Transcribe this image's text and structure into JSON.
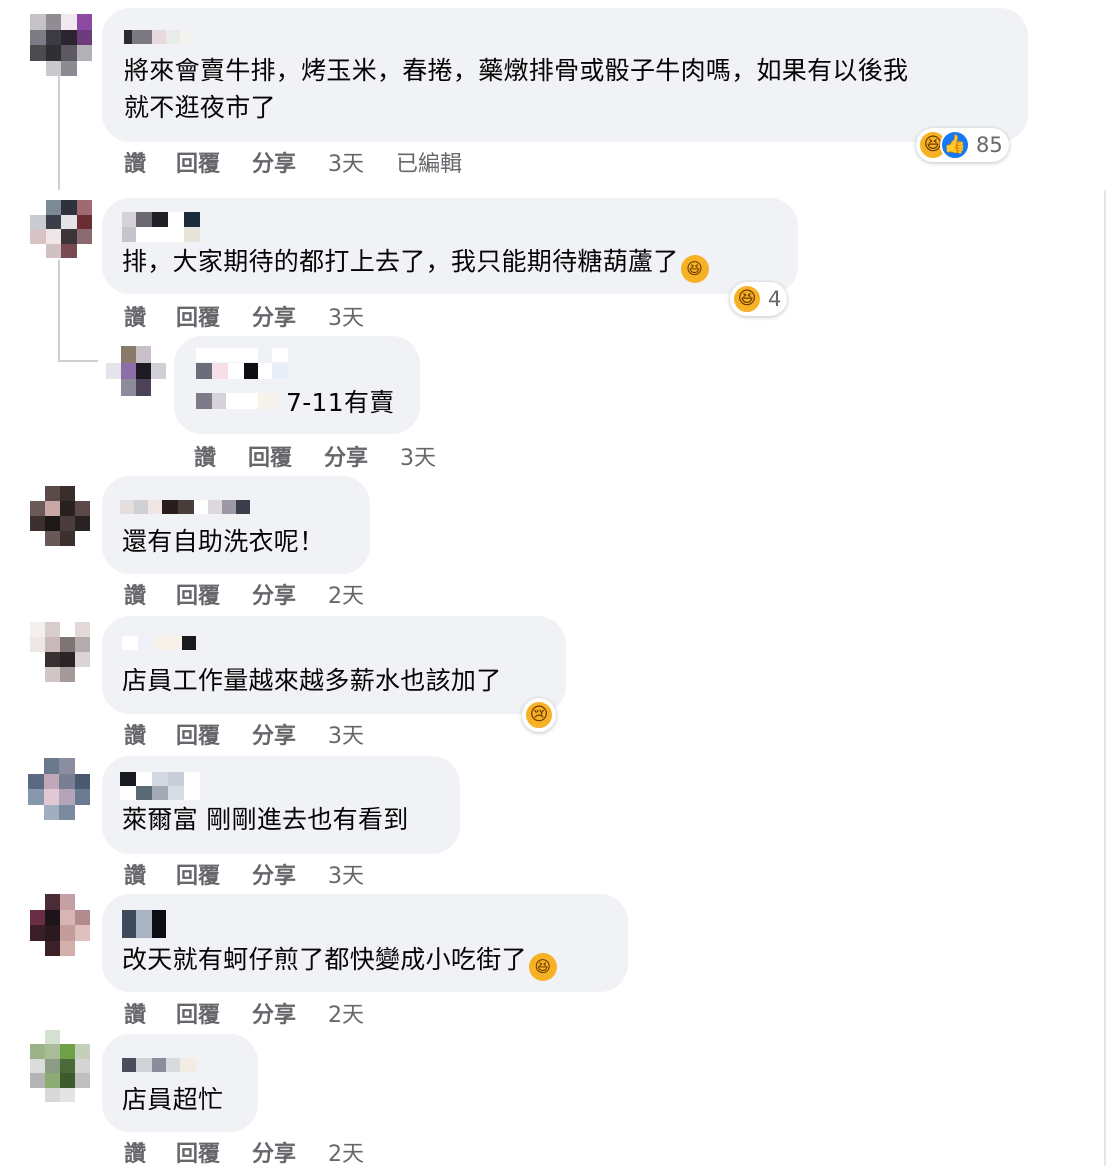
{
  "actions": {
    "like": "讚",
    "reply": "回覆",
    "share": "分享"
  },
  "emoji": {
    "haha": "😆",
    "like": "👍",
    "sad": "😢"
  },
  "comments": [
    {
      "text_line1": "將來會賣牛排，烤玉米，春捲，藥燉排骨或骰子牛肉嗎，如果有以後我",
      "text_line2": "就不逛夜市了",
      "time": "3天",
      "edited": "已編輯",
      "reaction_count": "85"
    },
    {
      "text": "排，大家期待的都打上去了，我只能期待糖葫蘆了",
      "time": "3天",
      "reaction_count": "4"
    },
    {
      "text": "7-11有賣",
      "time": "3天"
    },
    {
      "text": "還有自助洗衣呢！",
      "time": "2天"
    },
    {
      "text": "店員工作量越來越多薪水也該加了",
      "time": "3天"
    },
    {
      "text": "萊爾富 剛剛進去也有看到",
      "time": "3天"
    },
    {
      "text": "改天就有蚵仔煎了都快變成小吃街了",
      "time": "2天"
    },
    {
      "text": "店員超忙",
      "time": "2天"
    }
  ]
}
